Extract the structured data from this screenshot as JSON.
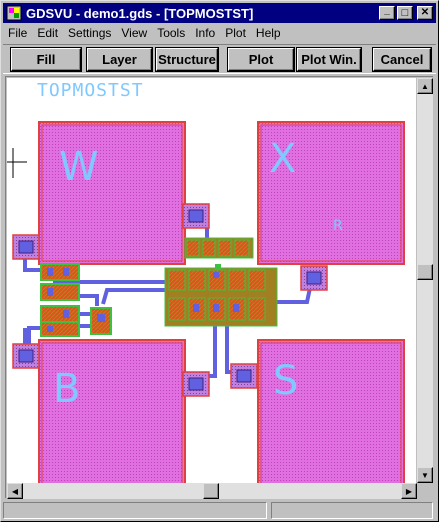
{
  "window": {
    "title": "GDSVU - demo1.gds - [TOPMOSTST]",
    "minimize_label": "_",
    "maximize_label": "□",
    "close_label": "✕"
  },
  "menu": [
    "File",
    "Edit",
    "Settings",
    "View",
    "Tools",
    "Info",
    "Plot",
    "Help"
  ],
  "toolbar": {
    "fill": "Fill",
    "layer": "Layer",
    "structure": "Structure",
    "plot": "Plot",
    "plot_win": "Plot Win.",
    "cancel": "Cancel"
  },
  "layout": {
    "cell_name": "TOPMOSTST",
    "pad_labels": [
      "W",
      "X",
      "B",
      "S"
    ],
    "small_label": "R"
  },
  "colors": {
    "pad_fill": "#e060e0",
    "pad_border": "#e04040",
    "label": "#80c8ff",
    "metal_blue": "#6060e0",
    "active_red": "#e04020",
    "poly_green": "#40c040",
    "orange": "#e08020"
  }
}
